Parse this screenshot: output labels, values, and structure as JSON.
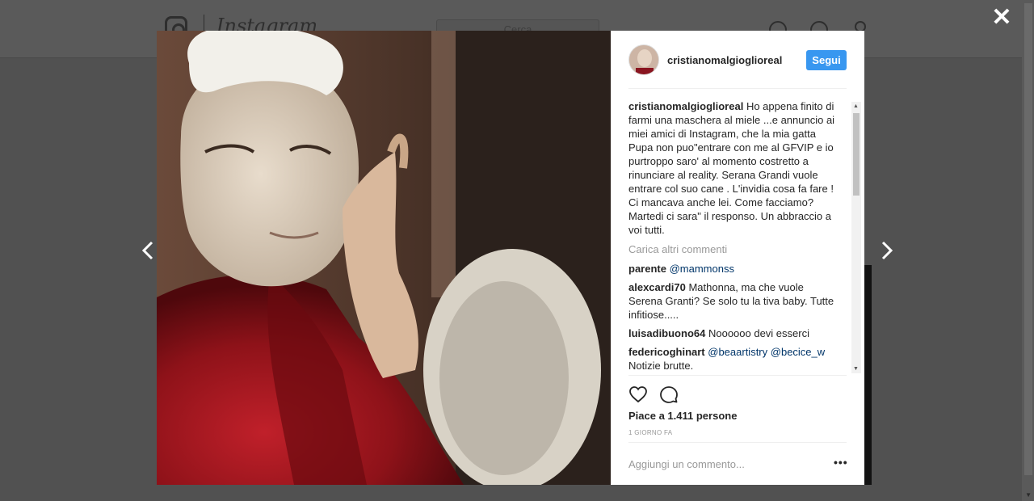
{
  "background": {
    "wordmark": "Instagram",
    "search_placeholder": "Cerca"
  },
  "modal": {
    "close_symbol": "✕",
    "prev_icon": "chevron-left-icon",
    "next_icon": "chevron-right-icon"
  },
  "post": {
    "username": "cristianomalgioglioreal",
    "follow_label": "Segui",
    "caption": {
      "user": "cristianomalgioglioreal",
      "text": "Ho appena finito di farmi una maschera al miele ...e annuncio ai miei amici di Instagram, che la mia gatta Pupa non puo\"entrare con me al GFVIP e io purtroppo saro' al momento costretto a rinunciare al reality. Serana Grandi vuole entrare col suo cane . L'invidia cosa fa fare ! Ci mancava anche lei. Come facciamo? Martedi ci sara\" il responso. Un abbraccio a voi tutti."
    },
    "load_more": "Carica altri commenti",
    "comments": [
      {
        "user": "parente",
        "mention1": "@mammonss",
        "text": ""
      },
      {
        "user": "alexcardi70",
        "text": "Mathonna, ma che vuole Serena Granti? Se solo tu la tiva baby. Tutte infitiose....."
      },
      {
        "user": "luisadibuono64",
        "text": "Noooooo devi esserci"
      },
      {
        "user": "federicoghinart",
        "mention1": "@beaartistry",
        "mention2": "@becice_w",
        "text": "Notizie brutte."
      }
    ],
    "likes": "Piace a 1.411 persone",
    "timestamp": "1 GIORNO FA",
    "comment_placeholder": "Aggiungi un commento...",
    "more_options": "•••"
  },
  "colors": {
    "accent": "#3897f0",
    "mention": "#003569",
    "overlay": "#515151"
  }
}
